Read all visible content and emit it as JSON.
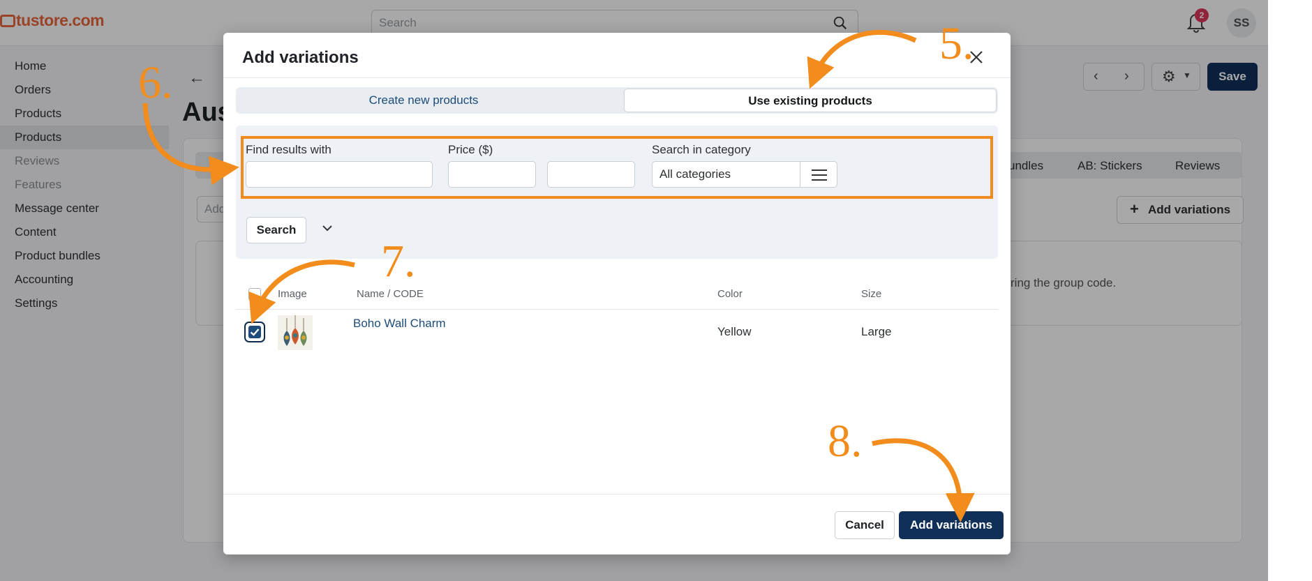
{
  "topbar": {
    "logo_text": "tustore.com",
    "search_placeholder": "Search",
    "notification_count": "2",
    "avatar_initials": "SS"
  },
  "sidebar": {
    "items": [
      {
        "label": "Home"
      },
      {
        "label": "Orders"
      },
      {
        "label": "Products"
      },
      {
        "label": "Products"
      },
      {
        "label": "Reviews"
      },
      {
        "label": "Features"
      },
      {
        "label": "Message center"
      },
      {
        "label": "Content"
      },
      {
        "label": "Product bundles"
      },
      {
        "label": "Accounting"
      },
      {
        "label": "Settings"
      }
    ]
  },
  "page": {
    "title": "Aus",
    "save_label": "Save",
    "add_placeholder": "Add",
    "tabs": [
      "undles",
      "AB: Stickers",
      "Reviews"
    ],
    "add_variations_label": "Add variations",
    "panel_text": "ring the group code."
  },
  "modal": {
    "title": "Add variations",
    "tabs": {
      "create": "Create new products",
      "existing": "Use existing products"
    },
    "filters": {
      "find_label": "Find results with",
      "price_label": "Price ($)",
      "price_separator": "-",
      "category_label": "Search in category",
      "category_value": "All categories",
      "search_button": "Search"
    },
    "table": {
      "headers": {
        "image": "Image",
        "name": "Name / CODE",
        "color": "Color",
        "size": "Size"
      },
      "rows": [
        {
          "name": "Boho Wall Charm",
          "color": "Yellow",
          "size": "Large",
          "checked": true
        }
      ]
    },
    "footer": {
      "cancel": "Cancel",
      "add": "Add variations"
    }
  },
  "annotations": {
    "step5": "5.",
    "step6": "6.",
    "step7": "7.",
    "step8": "8.",
    "color": "#f28c1c"
  },
  "colors": {
    "primary": "#10305a",
    "link": "#1d4b7a",
    "logo": "#e8663d",
    "badge": "#e0365a"
  }
}
